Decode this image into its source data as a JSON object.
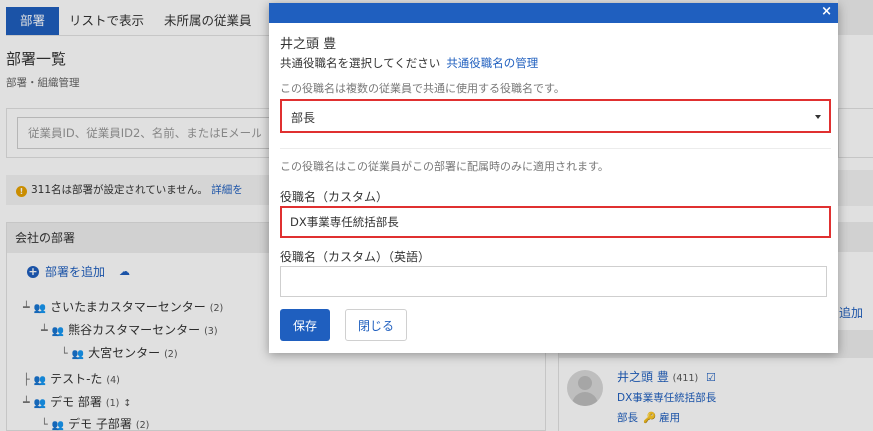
{
  "tabs": [
    {
      "label": "部署"
    },
    {
      "label": "リストで表示"
    },
    {
      "label": "未所属の従業員"
    }
  ],
  "header": {
    "title": "部署一覧",
    "subtitle": "部署・組織管理"
  },
  "search": {
    "placeholder": "従業員ID、従業員ID2、名前、またはEメール"
  },
  "notice": {
    "text": "311名は部署が設定されていません。",
    "link": "詳細を"
  },
  "departments_panel": {
    "title": "会社の部署",
    "add_label": "部署を追加",
    "tree": [
      {
        "name": "さいたまカスタマーセンター",
        "count": "(2)"
      },
      {
        "name": "熊谷カスタマーセンター",
        "count": "(3)"
      },
      {
        "name": "大宮センター",
        "count": "(2)"
      },
      {
        "name": "テスト-た",
        "count": "(4)"
      },
      {
        "name": "デモ 部署",
        "count": "(1)"
      },
      {
        "name": "デモ 子部署",
        "count": "(2)"
      }
    ]
  },
  "right_panel": {
    "add_label": "追加",
    "employee": {
      "name": "井之頭 豊",
      "id": "(411)",
      "title": "DX事業専任統括部長",
      "role": "部長",
      "status": "雇用"
    }
  },
  "modal": {
    "employee_name": "井之頭 豊",
    "select_prompt": "共通役職名を選択してください",
    "manage_link": "共通役職名の管理",
    "common_desc": "この役職名は複数の従業員で共通に使用する役職名です。",
    "selected_title": "部長",
    "custom_desc": "この役職名はこの従業員がこの部署に配属時のみに適用されます。",
    "custom_label": "役職名（カスタム）",
    "custom_value": "DX事業専任統括部長",
    "custom_en_label": "役職名（カスタム）（英語）",
    "custom_en_value": "",
    "save_label": "保存",
    "close_label": "閉じる",
    "close_icon": "×"
  },
  "colors": {
    "accent": "#1f5fbf",
    "highlight": "#e03030"
  }
}
